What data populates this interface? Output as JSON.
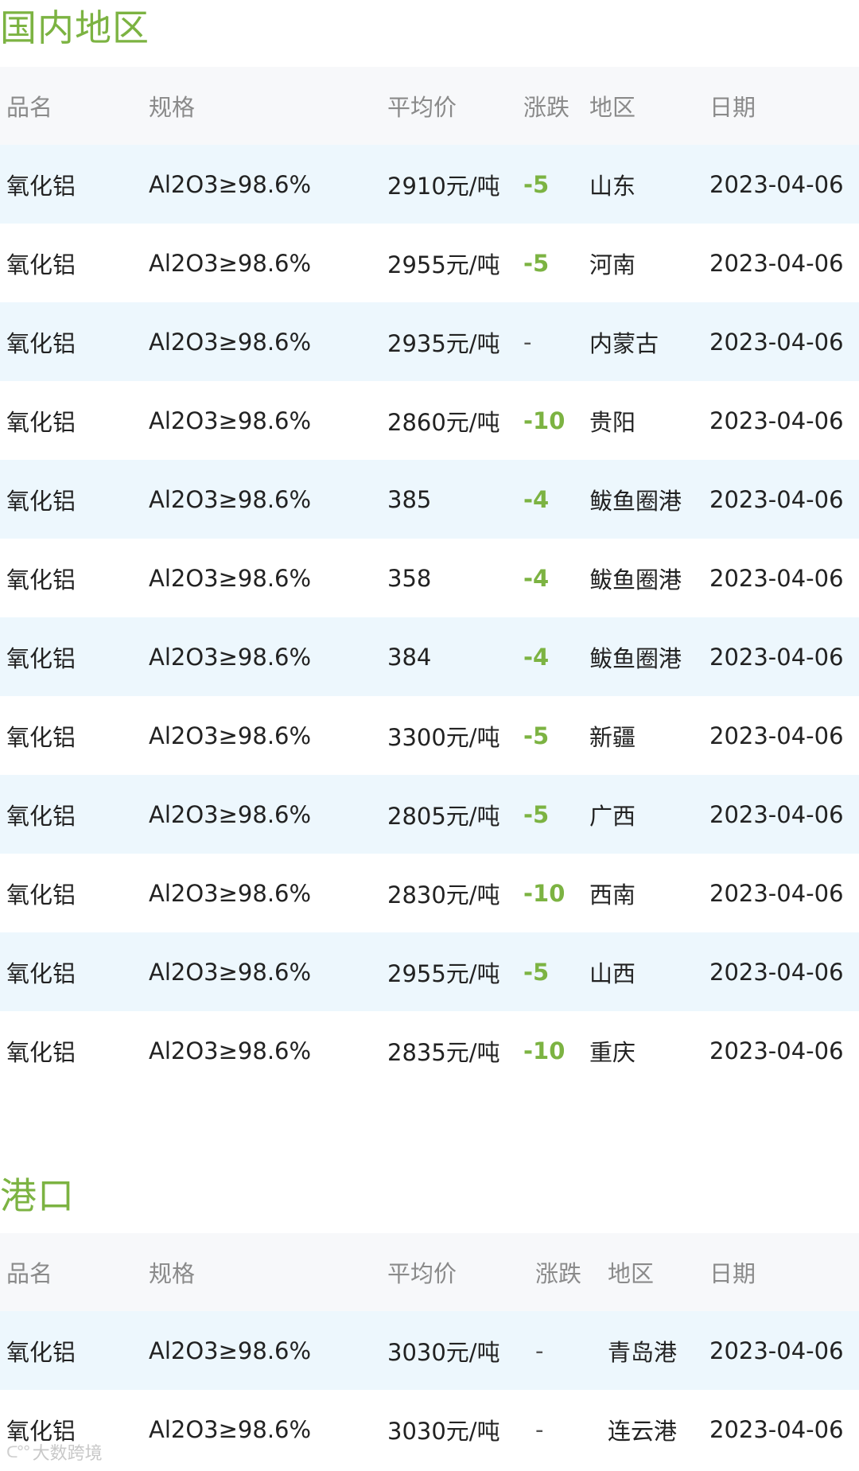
{
  "sections": [
    {
      "title": "国内地区",
      "headers": {
        "name": "品名",
        "spec": "规格",
        "price": "平均价",
        "change": "涨跌",
        "region": "地区",
        "date": "日期"
      },
      "rows": [
        {
          "name": "氧化铝",
          "spec": "Al2O3≥98.6%",
          "price": "2910元/吨",
          "change": "-5",
          "region": "山东",
          "date": "2023-04-06"
        },
        {
          "name": "氧化铝",
          "spec": "Al2O3≥98.6%",
          "price": "2955元/吨",
          "change": "-5",
          "region": "河南",
          "date": "2023-04-06"
        },
        {
          "name": "氧化铝",
          "spec": "Al2O3≥98.6%",
          "price": "2935元/吨",
          "change": "-",
          "region": "内蒙古",
          "date": "2023-04-06"
        },
        {
          "name": "氧化铝",
          "spec": "Al2O3≥98.6%",
          "price": "2860元/吨",
          "change": "-10",
          "region": "贵阳",
          "date": "2023-04-06"
        },
        {
          "name": "氧化铝",
          "spec": "Al2O3≥98.6%",
          "price": "385",
          "change": "-4",
          "region": "鲅鱼圈港",
          "date": "2023-04-06"
        },
        {
          "name": "氧化铝",
          "spec": "Al2O3≥98.6%",
          "price": "358",
          "change": "-4",
          "region": "鲅鱼圈港",
          "date": "2023-04-06"
        },
        {
          "name": "氧化铝",
          "spec": "Al2O3≥98.6%",
          "price": "384",
          "change": "-4",
          "region": "鲅鱼圈港",
          "date": "2023-04-06"
        },
        {
          "name": "氧化铝",
          "spec": "Al2O3≥98.6%",
          "price": "3300元/吨",
          "change": "-5",
          "region": "新疆",
          "date": "2023-04-06"
        },
        {
          "name": "氧化铝",
          "spec": "Al2O3≥98.6%",
          "price": "2805元/吨",
          "change": "-5",
          "region": "广西",
          "date": "2023-04-06"
        },
        {
          "name": "氧化铝",
          "spec": "Al2O3≥98.6%",
          "price": "2830元/吨",
          "change": "-10",
          "region": "西南",
          "date": "2023-04-06"
        },
        {
          "name": "氧化铝",
          "spec": "Al2O3≥98.6%",
          "price": "2955元/吨",
          "change": "-5",
          "region": "山西",
          "date": "2023-04-06"
        },
        {
          "name": "氧化铝",
          "spec": "Al2O3≥98.6%",
          "price": "2835元/吨",
          "change": "-10",
          "region": "重庆",
          "date": "2023-04-06"
        }
      ]
    },
    {
      "title": "港口",
      "headers": {
        "name": "品名",
        "spec": "规格",
        "price": "平均价",
        "change": "涨跌",
        "region": "地区",
        "date": "日期"
      },
      "rows": [
        {
          "name": "氧化铝",
          "spec": "Al2O3≥98.6%",
          "price": "3030元/吨",
          "change": "-",
          "region": "青岛港",
          "date": "2023-04-06"
        },
        {
          "name": "氧化铝",
          "spec": "Al2O3≥98.6%",
          "price": "3030元/吨",
          "change": "-",
          "region": "连云港",
          "date": "2023-04-06"
        }
      ]
    }
  ],
  "watermark": {
    "text": "大数跨境",
    "icon": "watermark-logo-icon"
  },
  "colors": {
    "accent_green": "#7cb342",
    "row_alt_bg": "#edf7fd",
    "header_bg": "#f7f8fa",
    "header_text": "#8a8a8a"
  }
}
